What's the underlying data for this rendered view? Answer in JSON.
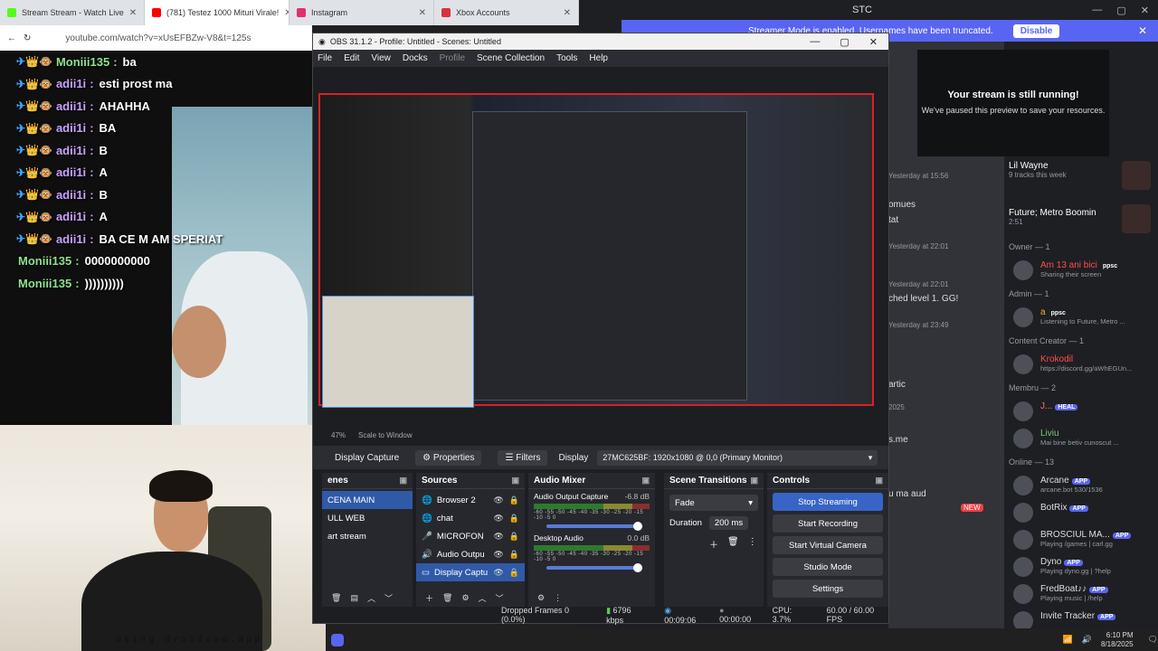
{
  "browser": {
    "tabs": [
      {
        "title": "Stream Stream - Watch Live",
        "active": false,
        "favicon_color": "#53fc18"
      },
      {
        "title": "(781) Testez 1000 Mituri Virale!",
        "active": true,
        "favicon_color": "#ff0000"
      },
      {
        "title": "Instagram",
        "active": false,
        "favicon_color": "#e1306c"
      },
      {
        "title": "Xbox Accounts",
        "active": false,
        "favicon_color": "#d9323a"
      }
    ],
    "close_glyph": "✕",
    "url": "youtube.com/watch?v=xUsEFBZw-V8&t=125s"
  },
  "stream_chat": [
    {
      "badges": "✈👑🐵",
      "user": "Moniii135",
      "msg": "ba",
      "green": true
    },
    {
      "badges": "✈👑🐵",
      "user": "adii1i",
      "msg": "esti prost ma",
      "green": false
    },
    {
      "badges": "✈👑🐵",
      "user": "adii1i",
      "msg": "AHAHHA",
      "green": false
    },
    {
      "badges": "✈👑🐵",
      "user": "adii1i",
      "msg": "BA",
      "green": false
    },
    {
      "badges": "✈👑🐵",
      "user": "adii1i",
      "msg": "B",
      "green": false
    },
    {
      "badges": "✈👑🐵",
      "user": "adii1i",
      "msg": "A",
      "green": false
    },
    {
      "badges": "✈👑🐵",
      "user": "adii1i",
      "msg": "B",
      "green": false
    },
    {
      "badges": "✈👑🐵",
      "user": "adii1i",
      "msg": "A",
      "green": false
    },
    {
      "badges": "✈👑🐵",
      "user": "adii1i",
      "msg": "BA CE M AM SPERIAT",
      "green": false
    },
    {
      "badges": "",
      "user": "Moniii135",
      "msg": "0000000000",
      "green": true
    },
    {
      "badges": "",
      "user": "Moniii135",
      "msg": "))))))))))",
      "green": true
    }
  ],
  "webcam_watermark": "using droidcam.app",
  "discord": {
    "title": "STC",
    "banner_text": "Streamer Mode is enabled. Usernames have been truncated.",
    "banner_button": "Disable",
    "preview_title": "Your stream is still running!",
    "preview_sub": "We've paused this preview to save your resources.",
    "messages": [
      {
        "text": "Yesterday at 15:56",
        "dim": true
      },
      {
        "text": "omues",
        "dim": false
      },
      {
        "text": "tat",
        "dim": false
      },
      {
        "text": "Yesterday at 22:01",
        "dim": true
      },
      {
        "text": "Yesterday at 22:01",
        "dim": true
      },
      {
        "text": "ched level 1. GG!",
        "dim": false
      },
      {
        "text": "Yesterday at 23:49",
        "dim": true
      },
      {
        "text": "artic",
        "dim": false
      },
      {
        "text": "2025",
        "dim": true
      },
      {
        "text": "s.me",
        "dim": false
      },
      {
        "text": "u ma aud",
        "dim": false
      },
      {
        "text": "NEW",
        "dim": true
      }
    ],
    "activity": [
      {
        "name": "Lil Wayne",
        "sub": "9 tracks this week"
      },
      {
        "name": "Future; Metro Boomin",
        "sub": "2:51"
      }
    ],
    "member_groups": [
      {
        "header": "Owner — 1",
        "members": [
          {
            "name": "Am 13 ani bici",
            "tag": "ppsc",
            "sub": "Sharing their screen",
            "color": "#ff4d4d"
          }
        ]
      },
      {
        "header": "Admin — 1",
        "members": [
          {
            "name": "a",
            "tag": "ppsc",
            "sub": "Listening to Future, Metro ...",
            "color": "#f0b132"
          }
        ]
      },
      {
        "header": "Content Creator — 1",
        "members": [
          {
            "name": "Krokodil",
            "tag": "",
            "sub": "https://discord.gg/aWhEGUn...",
            "color": "#ff4d4d"
          }
        ]
      },
      {
        "header": "Membru — 2",
        "members": [
          {
            "name": "J...",
            "tag": "HEAL",
            "sub": "",
            "color": "#ff6b6b"
          },
          {
            "name": "Liviu",
            "tag": "",
            "sub": "Mai bine betiv cunoscut ...",
            "color": "#7bc67b"
          }
        ]
      },
      {
        "header": "Online — 13",
        "members": [
          {
            "name": "Arcane",
            "tag": "APP",
            "sub": "arcane.bot 530/1536",
            "color": "#dbdee1"
          },
          {
            "name": "BotRix",
            "tag": "APP",
            "sub": "",
            "color": "#dbdee1"
          },
          {
            "name": "BROSCIUL MA...",
            "tag": "APP",
            "sub": "Playing /games | carl.gg",
            "color": "#dbdee1"
          },
          {
            "name": "Dyno",
            "tag": "APP",
            "sub": "Playing dyno.gg | ?help",
            "color": "#dbdee1"
          },
          {
            "name": "FredBoat♪♪",
            "tag": "APP",
            "sub": "Playing music | /help",
            "color": "#dbdee1"
          },
          {
            "name": "Invite Tracker",
            "tag": "APP",
            "sub": "",
            "color": "#dbdee1"
          }
        ]
      }
    ]
  },
  "obs": {
    "title": "OBS 31.1.2 - Profile: Untitled - Scenes: Untitled",
    "menu": [
      "File",
      "Edit",
      "View",
      "Docks",
      "Profile",
      "Scene Collection",
      "Tools",
      "Help"
    ],
    "zoom": "47%",
    "scale_mode": "Scale to Window",
    "source_name": "Display Capture",
    "properties_label": "Properties",
    "filters_label": "Filters",
    "display_label": "Display",
    "display_value": "27MC625BF: 1920x1080 @ 0,0 (Primary Monitor)",
    "docks": {
      "scenes_title": "enes",
      "scenes": [
        {
          "name": "CENA MAIN",
          "selected": true
        },
        {
          "name": "ULL WEB",
          "selected": false
        },
        {
          "name": "art stream",
          "selected": false
        }
      ],
      "sources_title": "Sources",
      "sources": [
        {
          "name": "Browser 2",
          "icon": "🌐",
          "selected": false
        },
        {
          "name": "chat",
          "icon": "🌐",
          "selected": false
        },
        {
          "name": "MICROFON",
          "icon": "🎤",
          "selected": false
        },
        {
          "name": "Audio Outpu",
          "icon": "🔊",
          "selected": false
        },
        {
          "name": "Display Captu",
          "icon": "▭",
          "selected": true
        }
      ],
      "mixer_title": "Audio Mixer",
      "mixer": [
        {
          "name": "Audio Output Capture",
          "db": "-6.8 dB"
        },
        {
          "name": "Desktop Audio",
          "db": "0.0 dB"
        }
      ],
      "mixer_scale": "-60 -55 -50 -45 -40 -35 -30 -25 -20 -15 -10 -5 0",
      "transitions_title": "Scene Transitions",
      "transition_type": "Fade",
      "duration_label": "Duration",
      "duration_value": "200 ms",
      "controls_title": "Controls",
      "controls": [
        "Stop Streaming",
        "Start Recording",
        "Start Virtual Camera",
        "Studio Mode",
        "Settings"
      ]
    },
    "status": {
      "dropped": "Dropped Frames 0 (0.0%)",
      "bitrate": "6796 kbps",
      "stream_time": "00:09:06",
      "rec_time": "00:00:00",
      "cpu": "CPU: 3.7%",
      "fps": "60.00 / 60.00 FPS"
    }
  },
  "taskbar": {
    "time": "6:10 PM",
    "date": "8/18/2025"
  }
}
